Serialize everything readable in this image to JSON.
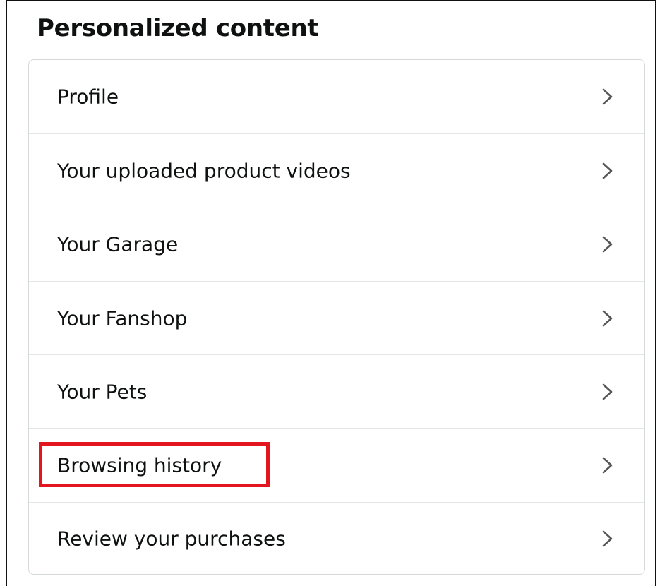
{
  "section": {
    "title": "Personalized content"
  },
  "menu": {
    "items": [
      {
        "label": "Profile",
        "icon": "chevron-right-icon"
      },
      {
        "label": "Your uploaded product videos",
        "icon": "chevron-right-icon"
      },
      {
        "label": "Your Garage",
        "icon": "chevron-right-icon"
      },
      {
        "label": "Your Fanshop",
        "icon": "chevron-right-icon"
      },
      {
        "label": "Your Pets",
        "icon": "chevron-right-icon"
      },
      {
        "label": "Browsing history",
        "icon": "chevron-right-icon",
        "highlighted": true
      },
      {
        "label": "Review your purchases",
        "icon": "chevron-right-icon"
      }
    ]
  },
  "colors": {
    "text": "#0f1111",
    "divider": "#e3e6e6",
    "card_border": "#d5d9d9",
    "chevron": "#555555",
    "highlight_box": "#e3151e"
  }
}
